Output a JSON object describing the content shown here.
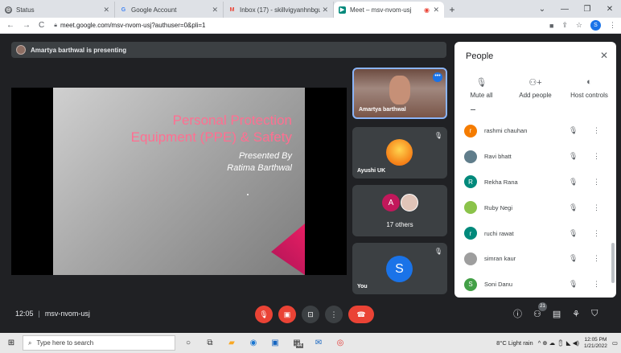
{
  "browser": {
    "tabs": [
      {
        "label": "Status",
        "icon": "status-icon",
        "active": false
      },
      {
        "label": "Google Account",
        "icon": "google-icon",
        "active": false
      },
      {
        "label": "Inbox (17) - skillvigyanhnbgu@g",
        "icon": "gmail-icon",
        "active": false
      },
      {
        "label": "Meet – msv-nvom-usj",
        "icon": "meet-icon",
        "active": true
      }
    ],
    "url": "meet.google.com/msv-nvom-usj?authuser=0&pli=1",
    "profile_initial": "S"
  },
  "stage": {
    "presenting_text": "Amartya barthwal is presenting",
    "slide": {
      "title_line1": "Personal Protection",
      "title_line2": "Equipment (PPE) & Safety",
      "presented_by": "Presented By",
      "presenter": "Ratima Barthwal"
    },
    "tiles": [
      {
        "name": "Amartya barthwal"
      },
      {
        "name": "Ayushi UK"
      },
      {
        "initial": "A",
        "others": "17 others"
      },
      {
        "name": "You",
        "initial": "S"
      }
    ]
  },
  "people": {
    "title": "People",
    "actions": [
      {
        "label": "Mute all",
        "icon": "mic-off-icon"
      },
      {
        "label": "Add people",
        "icon": "add-person-icon"
      },
      {
        "label": "Host controls",
        "icon": "toggle-icon"
      }
    ],
    "participants": [
      {
        "name": "rashmi chauhan",
        "initial": "r",
        "color": "#f57c00"
      },
      {
        "name": "Ravi bhatt",
        "initial": "",
        "color": "#607d8b"
      },
      {
        "name": "Rekha Rana",
        "initial": "R",
        "color": "#00897b"
      },
      {
        "name": "Ruby Negi",
        "initial": "",
        "color": "#8bc34a"
      },
      {
        "name": "ruchi rawat",
        "initial": "r",
        "color": "#00897b"
      },
      {
        "name": "simran kaur",
        "initial": "",
        "color": "#9e9e9e"
      },
      {
        "name": "Soni Danu",
        "initial": "S",
        "color": "#43a047"
      }
    ]
  },
  "controls": {
    "time": "12:05",
    "meeting_code": "msv-nvom-usj",
    "participant_count": "21"
  },
  "taskbar": {
    "search_placeholder": "Type here to search",
    "weather": "8°C  Light rain",
    "time": "12:05 PM",
    "date": "1/21/2022",
    "badge": "44"
  }
}
